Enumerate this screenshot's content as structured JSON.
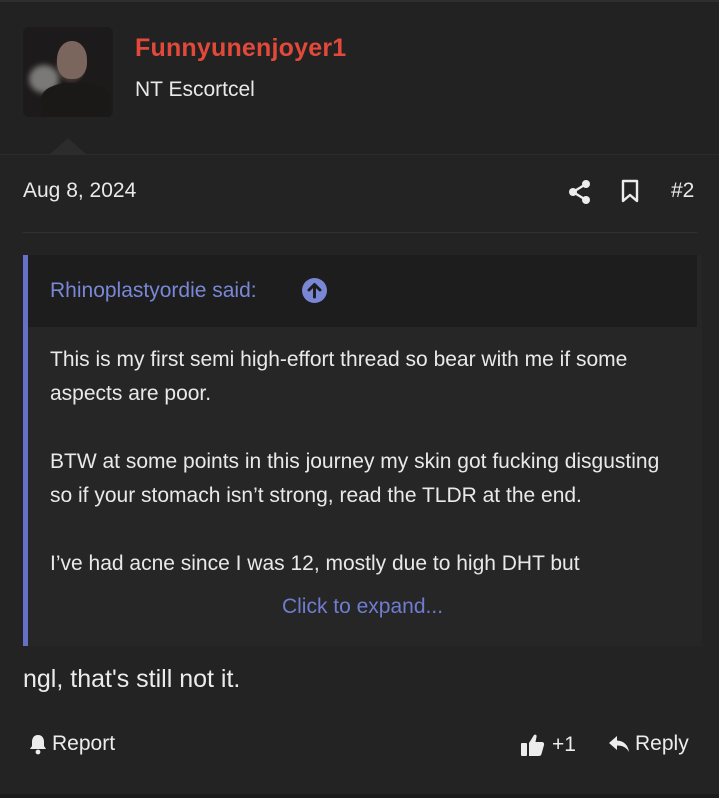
{
  "user": {
    "name": "Funnyunenjoyer1",
    "title": "NT Escortcel",
    "name_color": "#e2493a"
  },
  "post": {
    "date": "Aug 8, 2024",
    "number": "#2",
    "icons": [
      "share-icon",
      "bookmark-icon"
    ]
  },
  "quote": {
    "author_line": "Rhinoplastyordie said:",
    "accent_color": "#6471c7",
    "paragraphs": [
      "This is my first semi high-effort thread so bear with me if some aspects are poor.",
      "BTW at some points in this journey my skin got fucking disgusting so if your stomach isn’t strong, read the TLDR at the end.",
      "I’ve had acne since I was 12, mostly due to high DHT but"
    ],
    "expand_label": "Click to expand..."
  },
  "message": "ngl, that's still not it.",
  "actions": {
    "report_label": "Report",
    "like_count": "+1",
    "reply_label": "Reply"
  }
}
